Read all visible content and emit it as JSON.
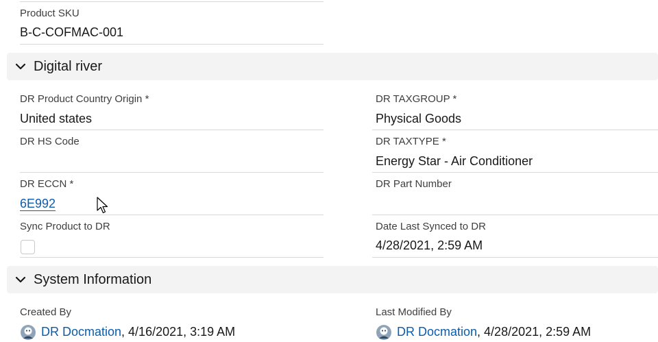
{
  "product": {
    "sku_label": "Product SKU",
    "sku_value": "B-C-COFMAC-001"
  },
  "digital_river": {
    "section_title": "Digital river",
    "country_origin_label": "DR Product Country Origin *",
    "country_origin_value": "United states",
    "taxgroup_label": "DR TAXGROUP *",
    "taxgroup_value": "Physical Goods",
    "hs_code_label": "DR HS Code",
    "hs_code_value": "",
    "taxtype_label": "DR TAXTYPE *",
    "taxtype_value": "Energy Star - Air Conditioner",
    "eccn_label": "DR ECCN *",
    "eccn_value": "6E992",
    "part_number_label": "DR Part Number",
    "part_number_value": "",
    "sync_label": "Sync Product to DR",
    "sync_checked": false,
    "last_synced_label": "Date Last Synced to DR",
    "last_synced_value": "4/28/2021, 2:59 AM"
  },
  "system_info": {
    "section_title": "System Information",
    "created_by_label": "Created By",
    "created_by_user": "DR Docmation",
    "created_by_date": ", 4/16/2021, 3:19 AM",
    "modified_by_label": "Last Modified By",
    "modified_by_user": "DR Docmation",
    "modified_by_date": ", 4/28/2021, 2:59 AM"
  },
  "icons": {
    "section_toggle": "chevron-down-icon",
    "user_avatar": "user-avatar-icon",
    "cursor": "mouse-pointer-icon"
  },
  "colors": {
    "link": "#0b5cab",
    "section_bg": "#f3f3f3",
    "divider": "#d8d8d8",
    "label": "#3e3e3c"
  }
}
